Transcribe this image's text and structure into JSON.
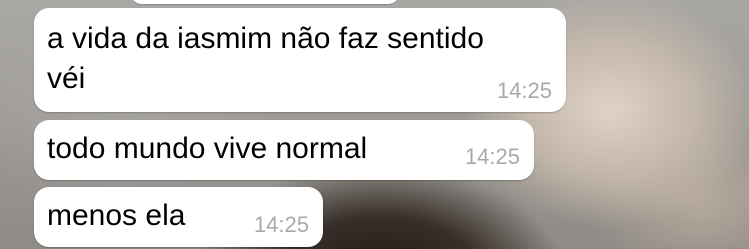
{
  "chat": {
    "messages": [
      {
        "lines": [
          "a vida da iasmim não faz sentido",
          "véi"
        ],
        "time": "14:25"
      },
      {
        "lines": [
          "todo mundo vive normal"
        ],
        "time": "14:25"
      },
      {
        "lines": [
          "menos ela"
        ],
        "time": "14:25"
      }
    ]
  }
}
